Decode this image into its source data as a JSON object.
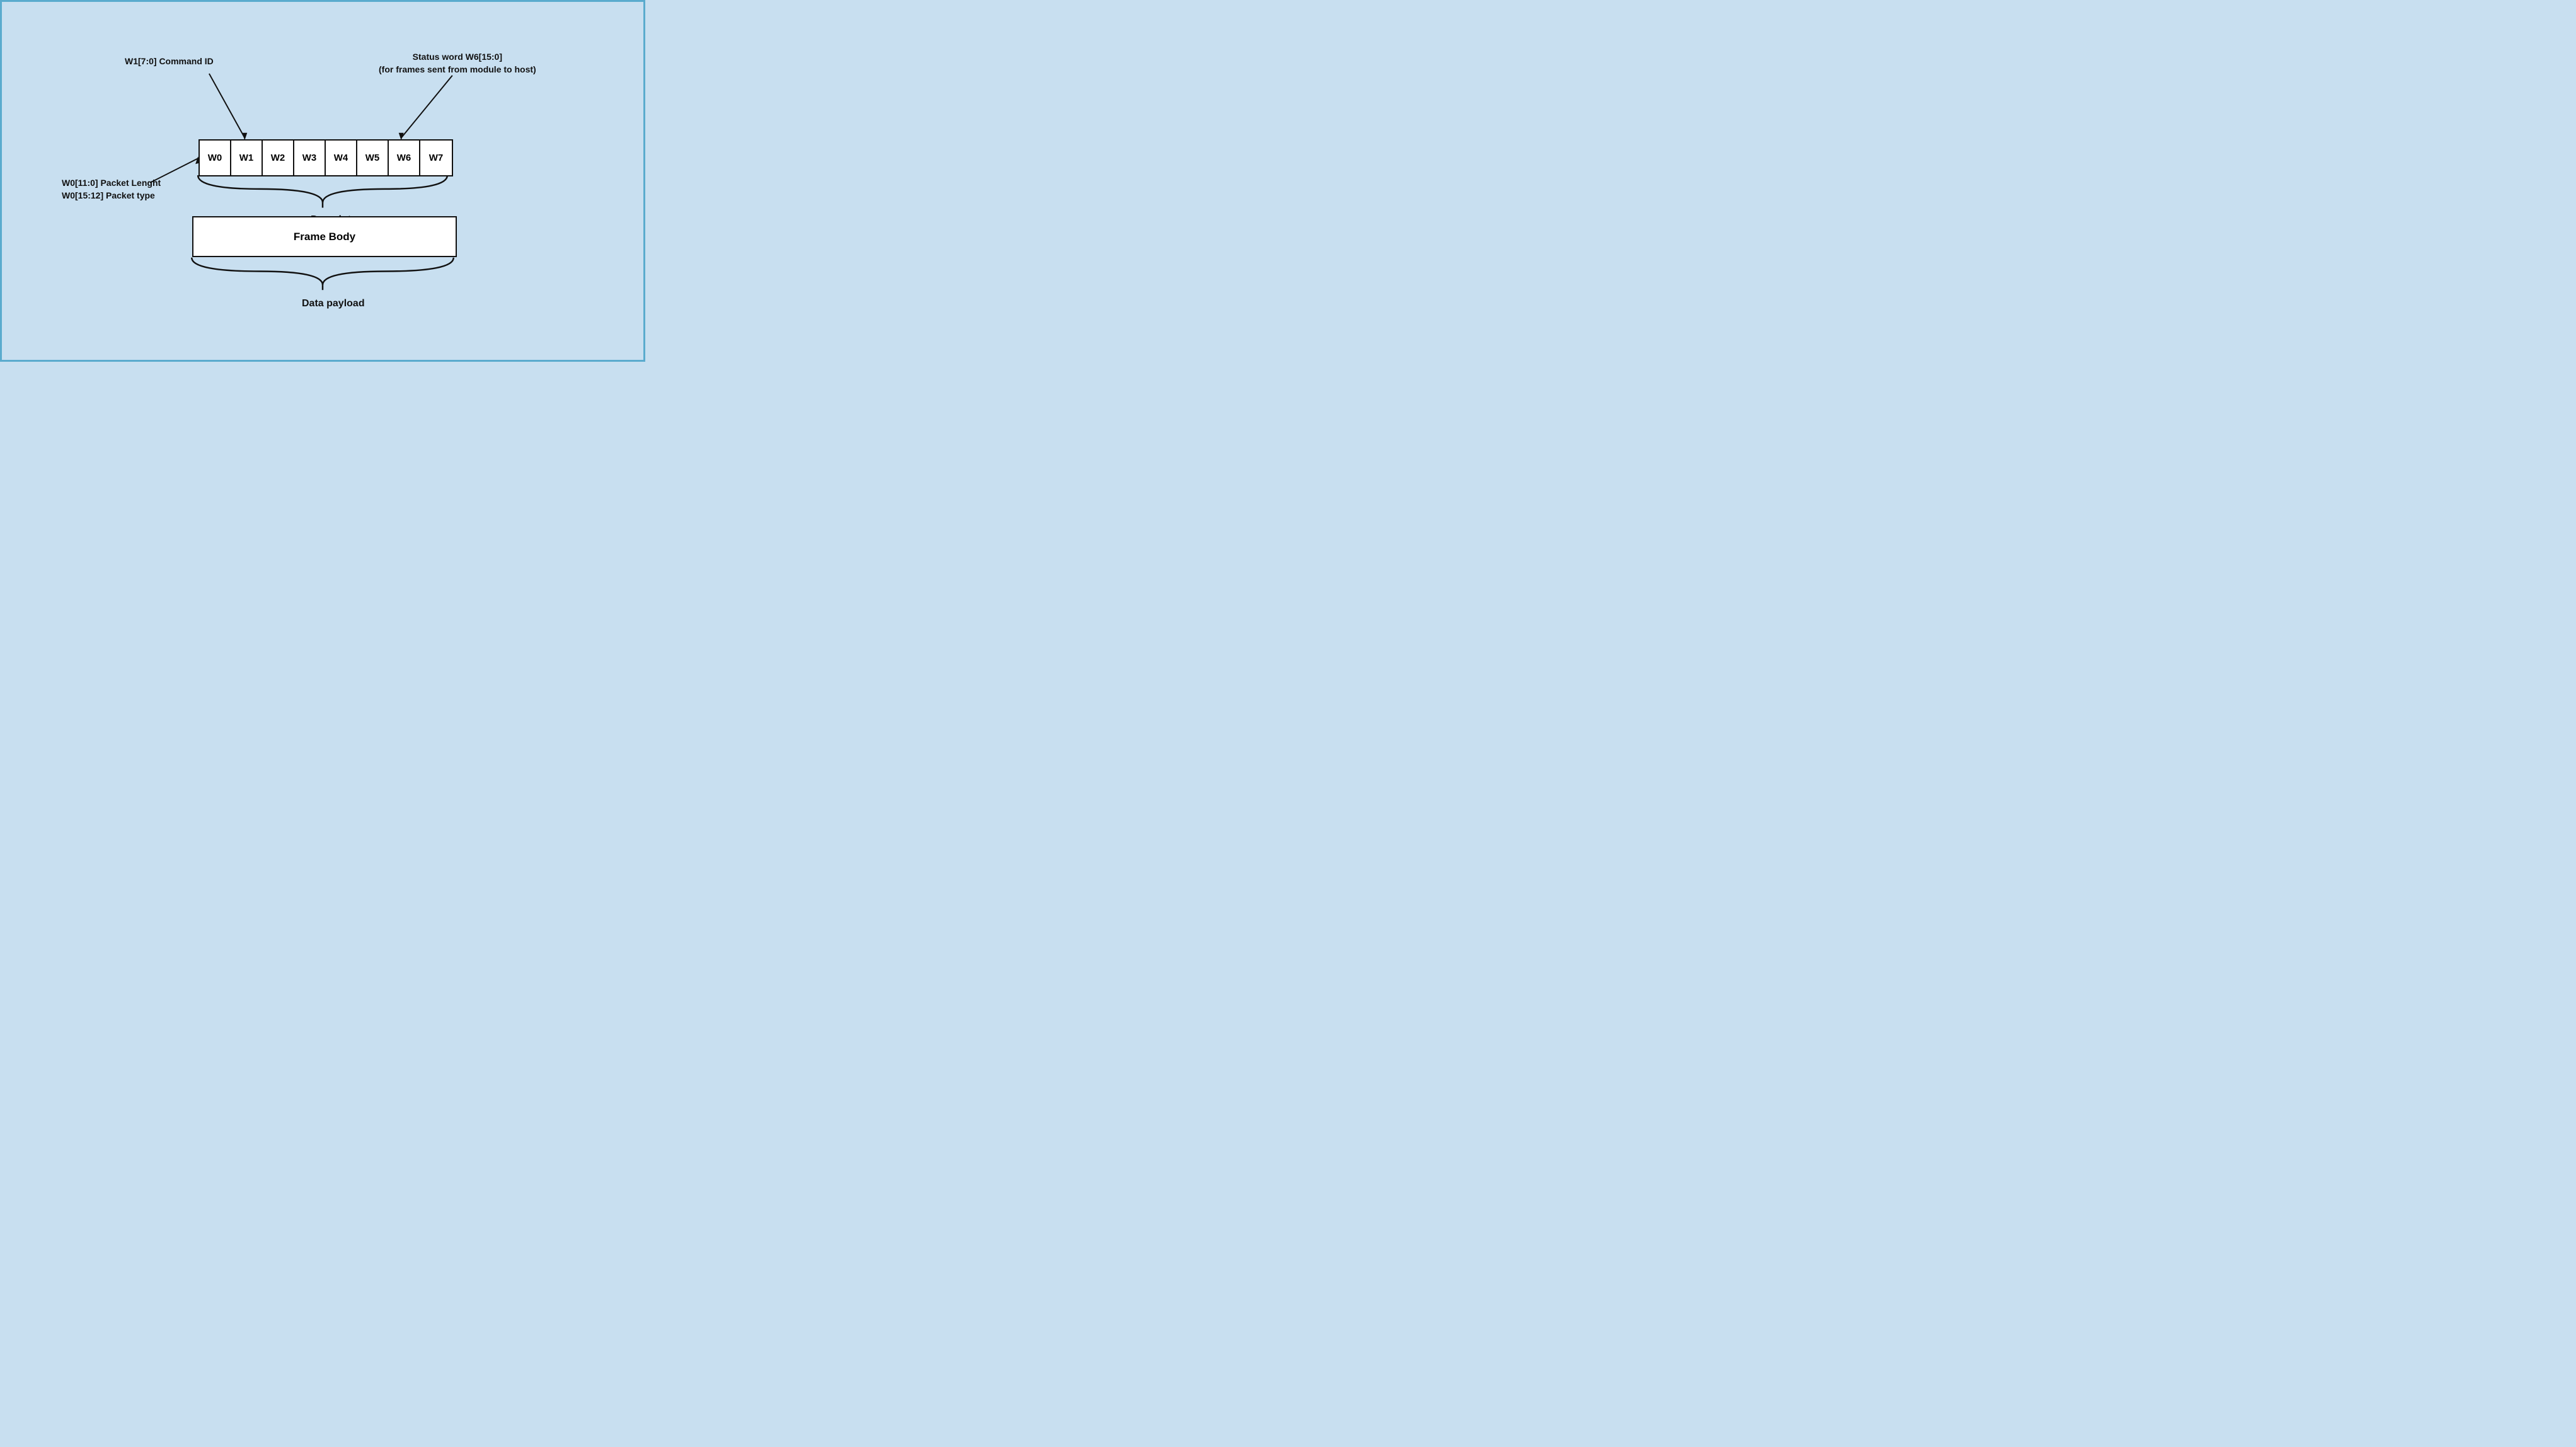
{
  "diagram": {
    "background_color": "#c8dff0",
    "border_color": "#5aabce",
    "descriptor": {
      "cells": [
        "W0",
        "W1",
        "W2",
        "W3",
        "W4",
        "W5",
        "W6",
        "W7"
      ],
      "label": "Descriptor"
    },
    "frame_body": {
      "label": "Frame Body"
    },
    "data_payload": {
      "label": "Data payload"
    },
    "annotations": {
      "command_id": "W1[7:0] Command ID",
      "status_word_line1": "Status word W6[15:0]",
      "status_word_line2": "(for frames sent from module to host)",
      "packet_length": "W0[11:0] Packet Lenght",
      "packet_type": "W0[15:12] Packet type"
    }
  }
}
